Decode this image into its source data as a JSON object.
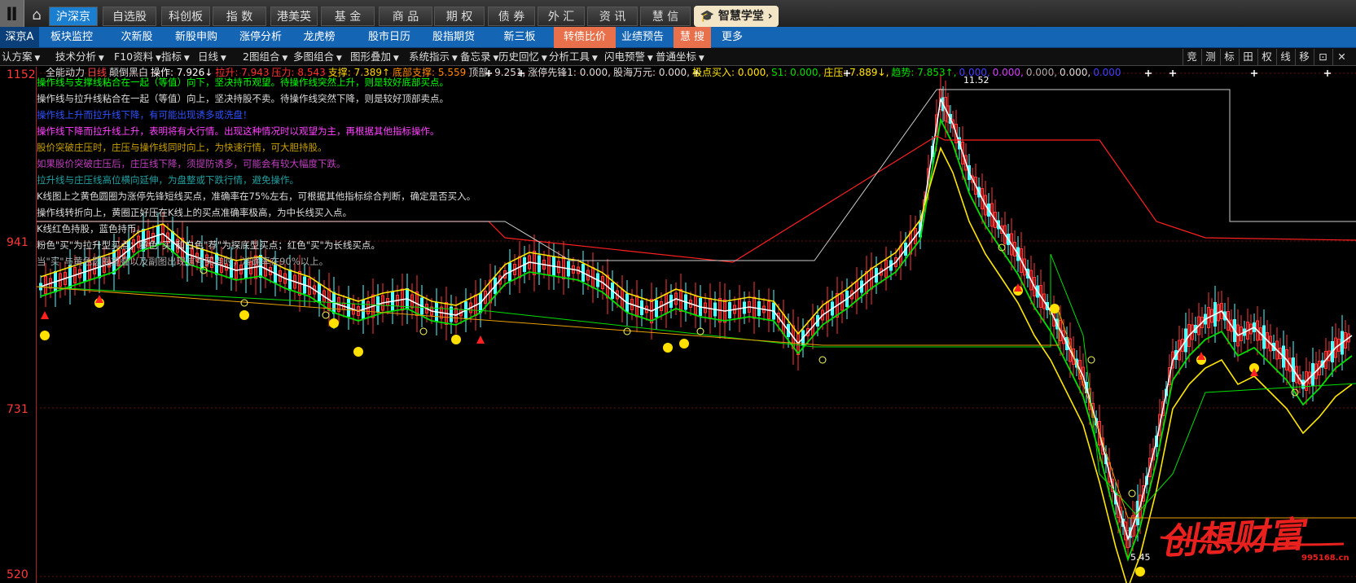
{
  "topbar": {
    "logo": "Ⅱ",
    "tabs": [
      "沪深京",
      "自选股",
      "科创板",
      "指 数",
      "港美英",
      "基 金",
      "商 品",
      "期 权",
      "债 券",
      "外 汇",
      "资 讯",
      "慧 信"
    ],
    "academy": "智慧学堂"
  },
  "subbar": {
    "left": "深京A",
    "tabs": [
      "板块监控",
      "次新股",
      "新股申购",
      "涨停分析",
      "龙虎榜",
      "股市日历",
      "股指期货",
      "新三板",
      "转债比价",
      "业绩预告",
      "慧 搜",
      "更多"
    ]
  },
  "toolbar": {
    "items": [
      "认方案",
      "技术分析",
      "F10资料",
      "指标",
      "日线",
      "2图组合",
      "多图组合",
      "图形叠加",
      "系统指示",
      "备忘录",
      "历史回忆",
      "分析工具",
      "闪电预警",
      "普通坐标"
    ],
    "right": [
      "竞",
      "测",
      "标",
      "田",
      "权",
      "线",
      "移",
      "⊡",
      "✕"
    ]
  },
  "info_line": [
    {
      "text": "全能动力",
      "color": "#dddddd"
    },
    {
      "text": "日线",
      "color": "#ff4040"
    },
    {
      "text": "颠倒黑白",
      "color": "#dddddd"
    },
    {
      "text": "操作: 7.926↓",
      "color": "#ffffff"
    },
    {
      "text": "拉升: 7.943",
      "color": "#ff3030"
    },
    {
      "text": "压力: 8.543",
      "color": "#ff3030"
    },
    {
      "text": "支撑: 7.389↑",
      "color": "#ffd400"
    },
    {
      "text": "底部支撑: 5.559",
      "color": "#ff8a00"
    },
    {
      "text": "顶部: 9.251,",
      "color": "#dddddd"
    },
    {
      "text": "涨停先锋1: 0.000,",
      "color": "#dddddd"
    },
    {
      "text": "股海万元: 0.000,",
      "color": "#dddddd"
    },
    {
      "text": "极点买入: 0.000,",
      "color": "#ffe600"
    },
    {
      "text": "S1: 0.000,",
      "color": "#00e000"
    },
    {
      "text": "庄压: 7.889↓,",
      "color": "#ffe600"
    },
    {
      "text": "趋势: 7.853↑,",
      "color": "#00e000"
    },
    {
      "text": "0.000,",
      "color": "#4040ff"
    },
    {
      "text": "0.000,",
      "color": "#d040ff"
    },
    {
      "text": "0.000,",
      "color": "#aaaaaa"
    },
    {
      "text": "0.000,",
      "color": "#dddddd"
    },
    {
      "text": "0.000",
      "color": "#4040ff"
    }
  ],
  "annotations": [
    {
      "text": "操作线与支撑线粘合在一起（等值）向下，坚决持币观望。待操作线突然上升，则是较好底部买点。",
      "color": "#00ff00"
    },
    {
      "text": "操作线与拉升线粘合在一起（等值）向上，坚决持股不卖。待操作线突然下降，则是较好顶部卖点。",
      "color": "#dddddd"
    },
    {
      "text": "操作线上升而拉升线下降，有可能出现诱多或洗盘！",
      "color": "#3050ff"
    },
    {
      "text": "操作线下降而拉升线上升，表明将有大行情。出现这种情况时以观望为主，再根据其他指标操作。",
      "color": "#ff40ff"
    },
    {
      "text": "股价突破庄压时，庄压与操作线同时向上，为快速行情，可大胆持股。",
      "color": "#c8a000"
    },
    {
      "text": "如果股价突破庄压后，庄压线下降，须提防诱多，可能会有较大幅度下跌。",
      "color": "#c040c0"
    },
    {
      "text": "拉升线与庄压线高位横向延伸，为盘整或下跌行情，避免操作。",
      "color": "#20a0a0"
    },
    {
      "text": "K线图上之黄色圆圈为涨停先锋短线买点，准确率在75%左右，可根据其他指标综合判断，确定是否买入。",
      "color": "#dddddd"
    },
    {
      "text": "操作线转折向上，黄圈正好压在K线上的买点准确率极高，为中长线买入点。",
      "color": "#dddddd"
    },
    {
      "text": "K线红色持股，蓝色持币。",
      "color": "#dddddd"
    },
    {
      "text": "粉色\"买\"为拉升型买点；黄色\"买\"和白色\"荐\"为探底型买点；红色\"买\"为长线买点。",
      "color": "#dddddd"
    },
    {
      "text": "当\"买\"与黄色圆圈重叠以及副图出现信号买点时，准确率在90%以上。",
      "color": "#aaaaaa"
    }
  ],
  "axis": {
    "labels": [
      "1152",
      "941",
      "731",
      "520"
    ],
    "high_label": "11.52",
    "low_label": "5.45"
  },
  "watermark": {
    "text": "创想财富",
    "site": "995168.cn"
  },
  "colors": {
    "up": "#ff3838",
    "down": "#54ffff",
    "operation": "#ffffff",
    "pull": "#ff2020",
    "pressure": "#ffe600",
    "support": "#00e000",
    "base": "#e8a000",
    "grey": "#cccccc"
  }
}
